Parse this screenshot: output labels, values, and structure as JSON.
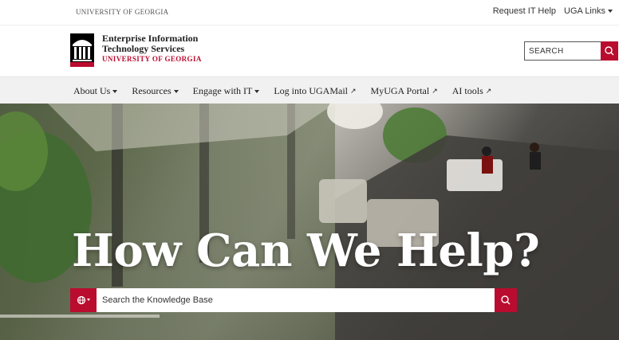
{
  "topbar": {
    "university": "UNIVERSITY OF GEORGIA",
    "request_help": "Request IT Help",
    "uga_links": "UGA Links"
  },
  "header": {
    "logo_line1": "Enterprise Information",
    "logo_line2": "Technology Services",
    "logo_line3": "UNIVERSITY OF GEORGIA",
    "search_placeholder": "SEARCH"
  },
  "nav": {
    "items": [
      {
        "label": "About Us",
        "type": "dropdown"
      },
      {
        "label": "Resources",
        "type": "dropdown"
      },
      {
        "label": "Engage with IT",
        "type": "dropdown"
      },
      {
        "label": "Log into UGAMail",
        "type": "external"
      },
      {
        "label": "MyUGA Portal",
        "type": "external"
      },
      {
        "label": "AI tools",
        "type": "external"
      }
    ]
  },
  "hero": {
    "title": "How Can We Help?",
    "search_placeholder": "Search the Knowledge Base"
  },
  "colors": {
    "brand_red": "#ba0c2f",
    "nav_bg": "#f1f1f1"
  },
  "icons": {
    "search": "search-icon",
    "external": "external-link-icon",
    "globe": "globe-icon",
    "caret": "chevron-down-icon"
  }
}
